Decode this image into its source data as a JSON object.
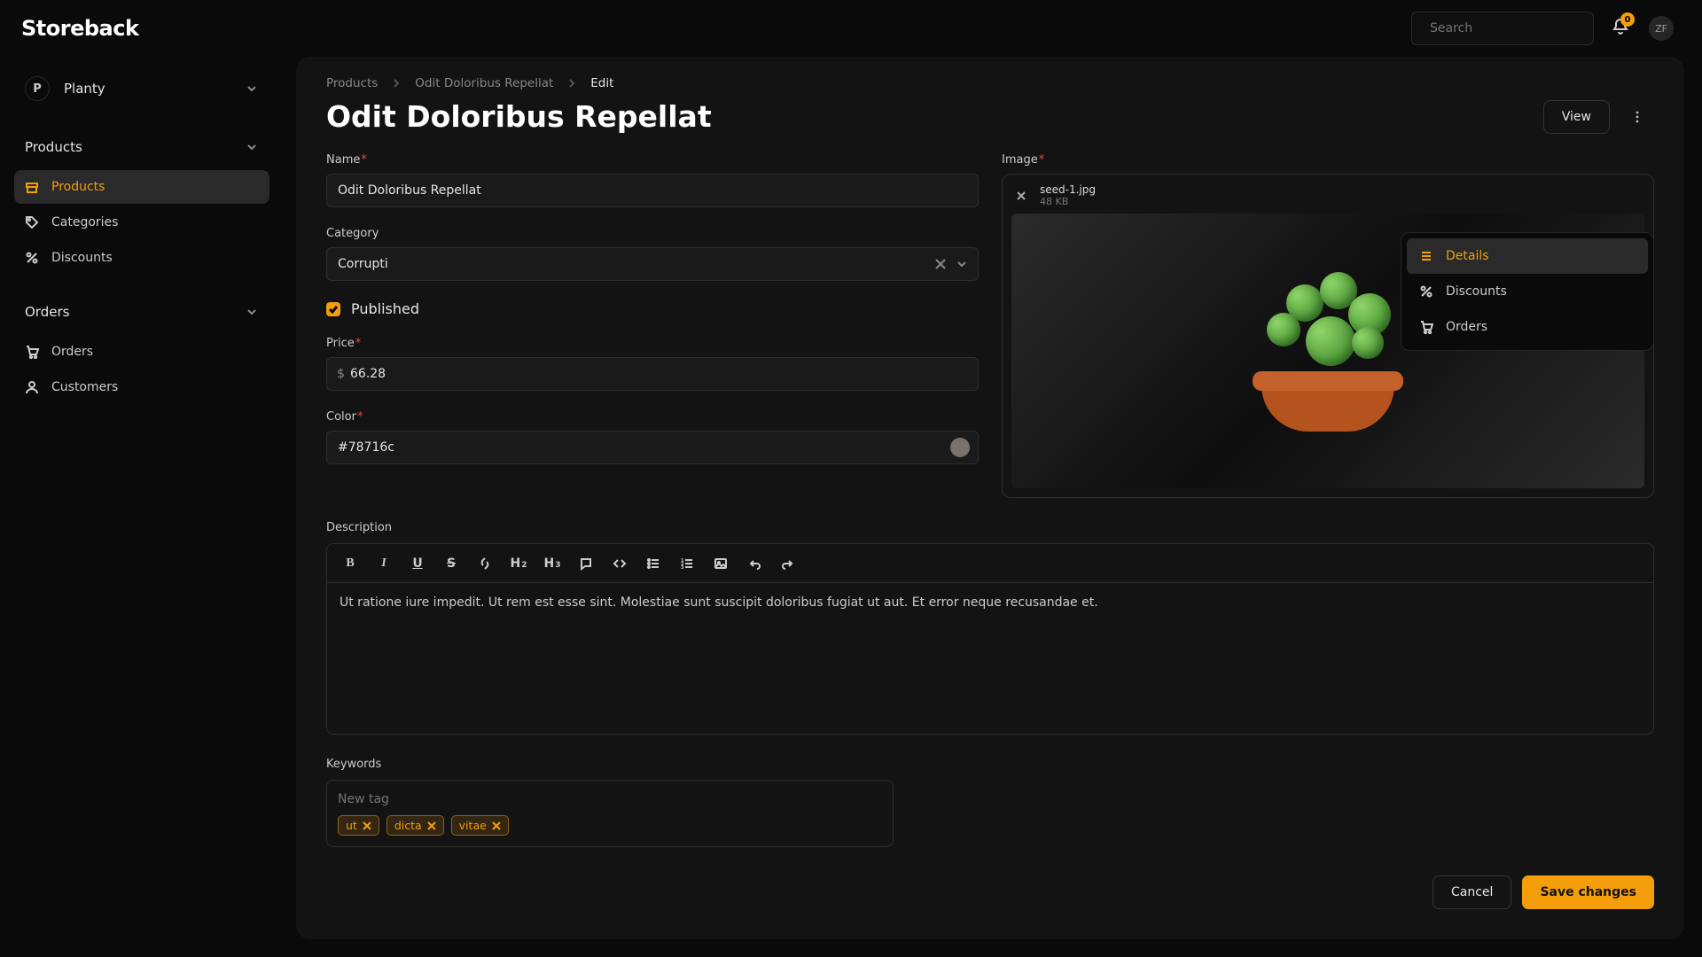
{
  "brand": "Storeback",
  "search": {
    "placeholder": "Search"
  },
  "notifications": {
    "count": "0"
  },
  "user": {
    "initials": "ZF"
  },
  "org": {
    "initial": "P",
    "name": "Planty"
  },
  "sidebar": {
    "groups": [
      {
        "label": "Products",
        "items": [
          {
            "label": "Products",
            "icon": "archive",
            "active": true
          },
          {
            "label": "Categories",
            "icon": "tag",
            "active": false
          },
          {
            "label": "Discounts",
            "icon": "percent",
            "active": false
          }
        ]
      },
      {
        "label": "Orders",
        "items": [
          {
            "label": "Orders",
            "icon": "cart",
            "active": false
          },
          {
            "label": "Customers",
            "icon": "user",
            "active": false
          }
        ]
      }
    ]
  },
  "breadcrumbs": [
    {
      "label": "Products"
    },
    {
      "label": "Odit Doloribus Repellat"
    },
    {
      "label": "Edit"
    }
  ],
  "page_title": "Odit Doloribus Repellat",
  "actions": {
    "view": "View"
  },
  "rail": [
    {
      "label": "Details",
      "icon": "list",
      "active": true
    },
    {
      "label": "Discounts",
      "icon": "percent",
      "active": false
    },
    {
      "label": "Orders",
      "icon": "cart",
      "active": false
    }
  ],
  "form": {
    "name": {
      "label": "Name",
      "value": "Odit Doloribus Repellat"
    },
    "category": {
      "label": "Category",
      "value": "Corrupti"
    },
    "published": {
      "label": "Published",
      "checked": true
    },
    "price": {
      "label": "Price",
      "currency": "$",
      "value": "66.28"
    },
    "color": {
      "label": "Color",
      "value": "#78716c"
    },
    "image": {
      "label": "Image",
      "filename": "seed-1.jpg",
      "filesize": "48 KB"
    },
    "description": {
      "label": "Description",
      "value": "Ut ratione iure impedit. Ut rem est esse sint. Molestiae sunt suscipit doloribus fugiat ut aut. Et error neque recusandae et."
    },
    "keywords": {
      "label": "Keywords",
      "placeholder": "New tag",
      "tags": [
        "ut",
        "dicta",
        "vitae"
      ]
    }
  },
  "footer": {
    "cancel": "Cancel",
    "save": "Save changes"
  }
}
